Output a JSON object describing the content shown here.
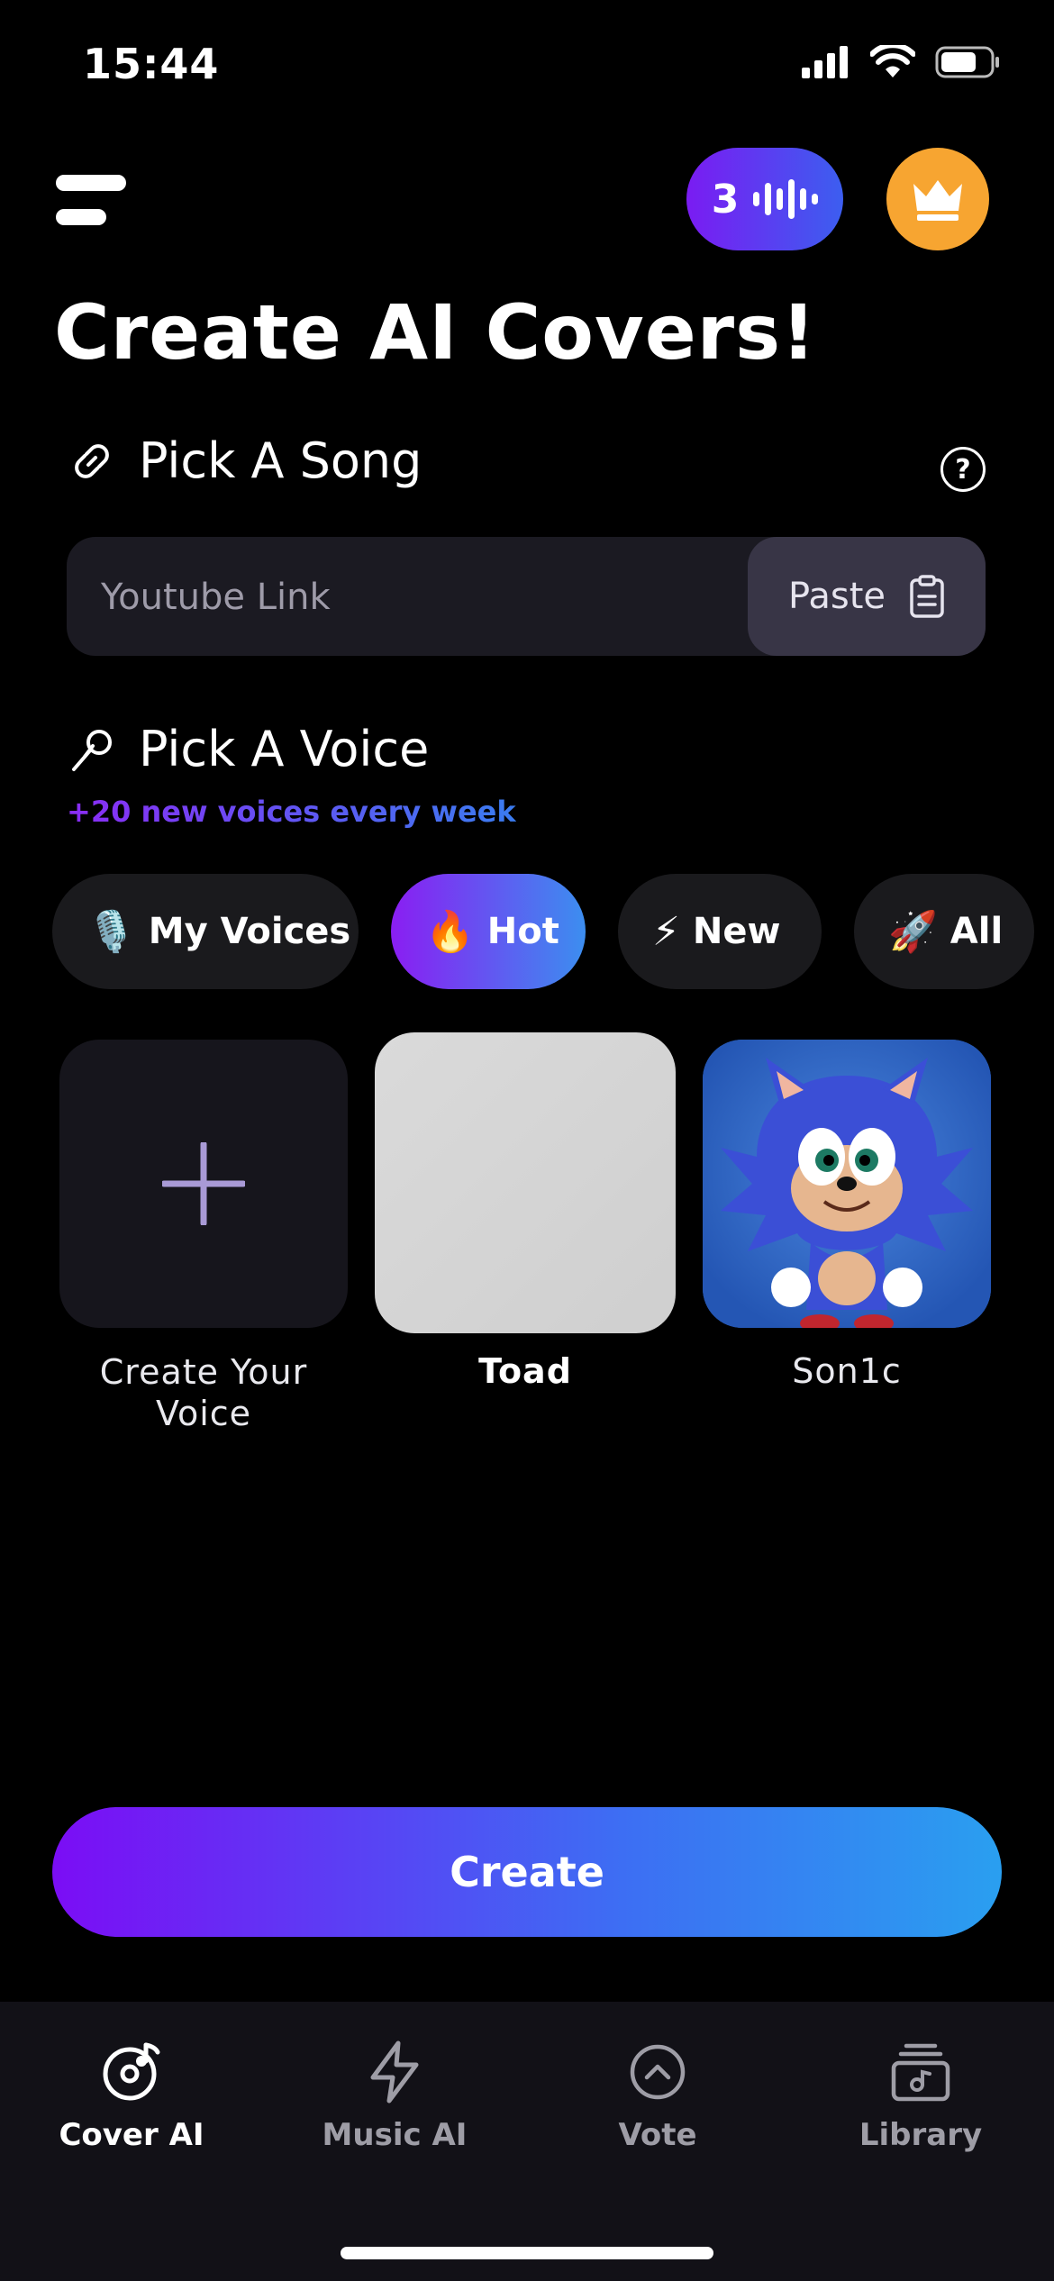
{
  "status_bar": {
    "time": "15:44"
  },
  "header": {
    "credits": "3",
    "credits_icon": "waveform-icon",
    "premium_icon": "crown-icon",
    "menu_icon": "menu-icon"
  },
  "title": "Create AI Covers!",
  "song_section": {
    "label": "Pick A Song",
    "input_placeholder": "Youtube Link",
    "paste_label": "Paste"
  },
  "voice_section": {
    "label": "Pick A Voice",
    "subtitle": "+20 new voices every week"
  },
  "filters": [
    {
      "emoji": "🎙️",
      "label": "My Voices",
      "active": false
    },
    {
      "emoji": "🔥",
      "label": "Hot",
      "active": true
    },
    {
      "emoji": "⚡",
      "label": "New",
      "active": false
    },
    {
      "emoji": "🚀",
      "label": "All",
      "active": false
    }
  ],
  "voices": [
    {
      "label": "Create Your Voice"
    },
    {
      "label": "Toad"
    },
    {
      "label": "Son1c"
    }
  ],
  "create_button": "Create",
  "tabs": [
    {
      "label": "Cover AI",
      "icon": "music-disc-icon",
      "active": true
    },
    {
      "label": "Music AI",
      "icon": "lightning-icon",
      "active": false
    },
    {
      "label": "Vote",
      "icon": "chevron-up-circle-icon",
      "active": false
    },
    {
      "label": "Library",
      "icon": "library-icon",
      "active": false
    }
  ],
  "colors": {
    "accent_purple": "#7b0df5",
    "accent_blue": "#2a9ff0",
    "premium": "#f7a531"
  }
}
